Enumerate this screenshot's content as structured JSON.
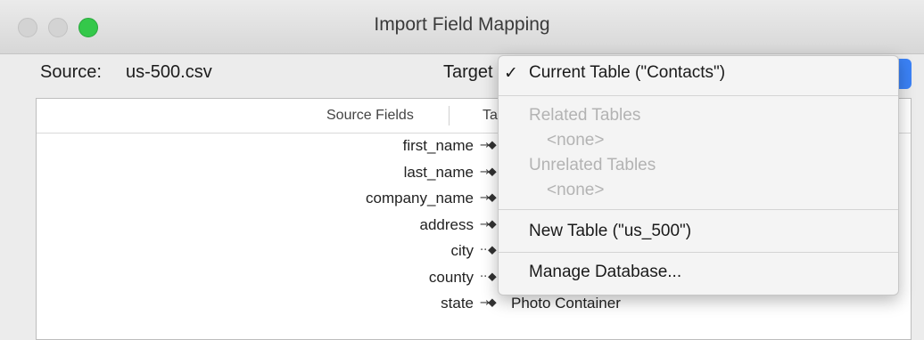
{
  "window": {
    "title": "Import Field Mapping"
  },
  "source": {
    "label": "Source:",
    "value": "us-500.csv"
  },
  "target": {
    "label": "Target"
  },
  "table": {
    "col_source": "Source Fields",
    "col_target": "Ta",
    "rows": [
      {
        "source": "first_name",
        "arrow": "→",
        "target": ""
      },
      {
        "source": "last_name",
        "arrow": "→",
        "target": ""
      },
      {
        "source": "company_name",
        "arrow": "→",
        "target": ""
      },
      {
        "source": "address",
        "arrow": "→",
        "target": ""
      },
      {
        "source": "city",
        "arrow": "··",
        "target": ""
      },
      {
        "source": "county",
        "arrow": "··",
        "target": ""
      },
      {
        "source": "state",
        "arrow": "→",
        "target": "Photo Container"
      }
    ]
  },
  "menu": {
    "check": "✓",
    "current_table": "Current Table (\"Contacts\")",
    "related_tables": "Related Tables",
    "related_none": "<none>",
    "unrelated_tables": "Unrelated Tables",
    "unrelated_none": "<none>",
    "new_table": "New Table (\"us_500\")",
    "manage_database": "Manage Database..."
  },
  "colors": {
    "accent": "#3b82f6",
    "maximize": "#34c84a",
    "disabled_text": "#b3b3b3"
  }
}
